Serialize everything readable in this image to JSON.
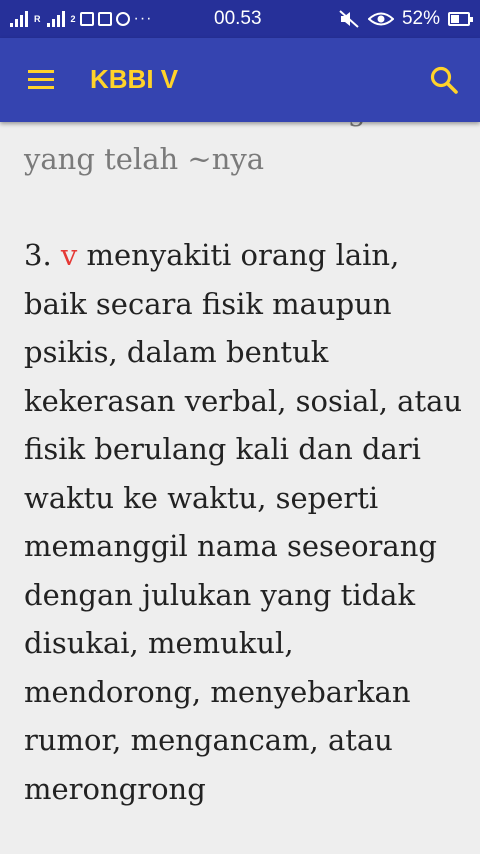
{
  "status_bar": {
    "time": "00.53",
    "battery": "52%",
    "battery_level": 0.52,
    "carrier_label": "R",
    "sim2_label": "2",
    "more_icons": "···"
  },
  "app_bar": {
    "title": "KBBI V",
    "menu_icon": "hamburger-menu-icon",
    "search_icon": "search-icon"
  },
  "definition": {
    "prev_line_partial": "ia tabah atas kemalangan",
    "prev_line_end": "yang telah ~nya",
    "number": "3.",
    "pos_label": "v",
    "text": "menyakiti orang lain, baik secara fisik maupun psikis, dalam bentuk kekerasan verbal, sosial, atau fisik berulang kali dan dari waktu ke waktu, seperti memanggil nama seseorang dengan julukan yang tidak disukai, memukul, mendorong, menyebarkan rumor, mengancam, atau merongrong"
  },
  "colors": {
    "status_bar": "#263099",
    "app_bar": "#3544b0",
    "accent": "#ffd32a",
    "pos_label": "#e53935",
    "background": "#eeeeee"
  }
}
